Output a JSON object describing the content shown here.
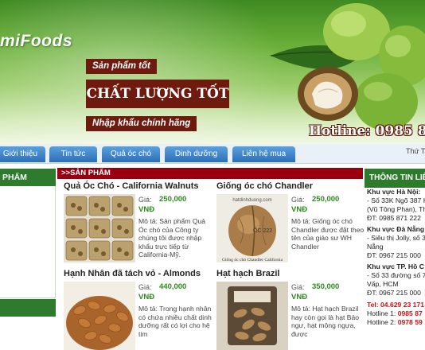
{
  "banner": {
    "logo": "miFoods",
    "tag_product": "Sản phẩm tốt",
    "tag_quality": "CHẤT LƯỢNG TỐT",
    "tag_import": "Nhập khẩu chính hãng",
    "hotline": "Hotline: 0985 87"
  },
  "nav": {
    "items": [
      "Giới thiệu",
      "Tin tức",
      "Quả óc chó",
      "Dinh dưỡng",
      "Liên hệ mua"
    ],
    "date": "Thứ T"
  },
  "left": {
    "heading": "PHẨM"
  },
  "center": {
    "heading": ">>SẢN PHẨM",
    "products": [
      {
        "title": "Quả Óc Chó - California Walnuts",
        "price_label": "Giá:",
        "price": "250,000",
        "currency": "VNĐ",
        "desc": "Mô tả:   Sản phẩm Quả Óc chó của Công ty chúng tôi được nhập khẩu trực tiếp từ California-Mỹ."
      },
      {
        "title": "Giống óc chó Chandler",
        "price_label": "Giá:",
        "price": "250,000",
        "currency": "VNĐ",
        "desc": "Mô tả:   Giống óc chó Chandler được đặt theo tên của giáo sư WH Chandler",
        "img_site": "hatdinhduong.com",
        "img_code": "ỐC 222",
        "img_caption": "Giống óc chó Chandler California"
      },
      {
        "title": "Hạnh Nhân đã tách vỏ - Almonds",
        "price_label": "Giá:",
        "price": "440,000",
        "currency": "VNĐ",
        "desc": "Mô tả:   Trong hạnh nhân có chứa nhiều chất dinh dưỡng rất có lợi cho hệ tim"
      },
      {
        "title": "Hạt hạch Brazil",
        "price_label": "Giá:",
        "price": "350,000",
        "currency": "VNĐ",
        "desc": "Mô tả:   Hạt hạch Brazil hay còn gọi là hạt Bảo ngư, hạt mộng ngựa, được"
      }
    ]
  },
  "right": {
    "heading": "THÔNG TIN LIÊ",
    "hn_title": "Khu vực Hà Nội:",
    "hn_1": "- Số 33K Ngõ 387 H",
    "hn_2": "(Vũ Tông Phan), Th",
    "hn_3": "ĐT: 0985 871 222",
    "dn_title": "Khu vực Đà Nẵng",
    "dn_1": "- Siêu thị Jolly, số 3",
    "dn_2": "Nẵng",
    "dn_3": "ĐT: 0967 215 000",
    "hcm_title": "Khu vực TP. Hồ C",
    "hcm_1": "- Số 33 đường số 7",
    "hcm_2": "Vấp, HCM",
    "hcm_3": "ĐT: 0967 215 000",
    "tel": "Tel: 04.629 23 171",
    "hotline1": "Hotline 1: 0985 87",
    "hotline2": "Hotline 2: 0978 59"
  },
  "colors": {
    "brand_green": "#2f7b2e",
    "section_red": "#98000f",
    "tag_brown": "#6e1a0e",
    "nav_blue": "#2d6eb6",
    "price_green": "#2b8a1a"
  }
}
